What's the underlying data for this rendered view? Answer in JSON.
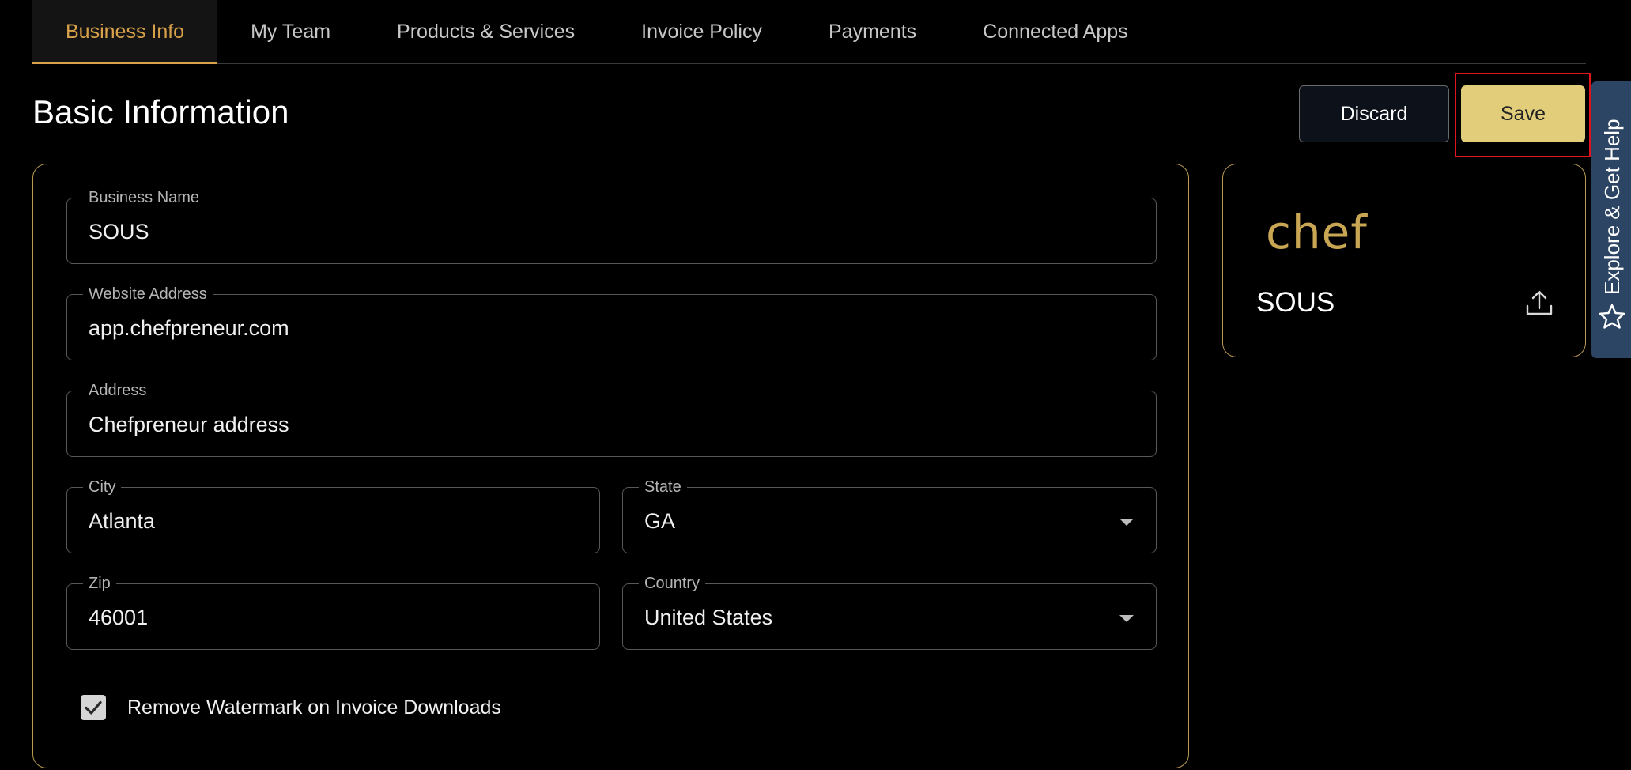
{
  "tabs": [
    {
      "label": "Business Info",
      "active": true
    },
    {
      "label": "My Team",
      "active": false
    },
    {
      "label": "Products & Services",
      "active": false
    },
    {
      "label": "Invoice Policy",
      "active": false
    },
    {
      "label": "Payments",
      "active": false
    },
    {
      "label": "Connected Apps",
      "active": false
    }
  ],
  "page_title": "Basic Information",
  "actions": {
    "discard_label": "Discard",
    "save_label": "Save"
  },
  "form": {
    "business_name": {
      "label": "Business Name",
      "value": "SOUS"
    },
    "website": {
      "label": "Website Address",
      "value": "app.chefpreneur.com"
    },
    "address": {
      "label": "Address",
      "value": "Chefpreneur address"
    },
    "city": {
      "label": "City",
      "value": "Atlanta"
    },
    "state": {
      "label": "State",
      "value": "GA"
    },
    "zip": {
      "label": "Zip",
      "value": "46001"
    },
    "country": {
      "label": "Country",
      "value": "United States"
    },
    "watermark": {
      "label": "Remove Watermark on Invoice Downloads",
      "checked": true
    }
  },
  "profile": {
    "logo_text": "chef",
    "name": "SOUS"
  },
  "help": {
    "label": "Explore & Get Help"
  },
  "colors": {
    "accent": "#d9a24a",
    "save_bg": "#e2cd7a",
    "card_border": "#b99a55",
    "help_bg": "#2c4565",
    "highlight": "#e0141e"
  }
}
